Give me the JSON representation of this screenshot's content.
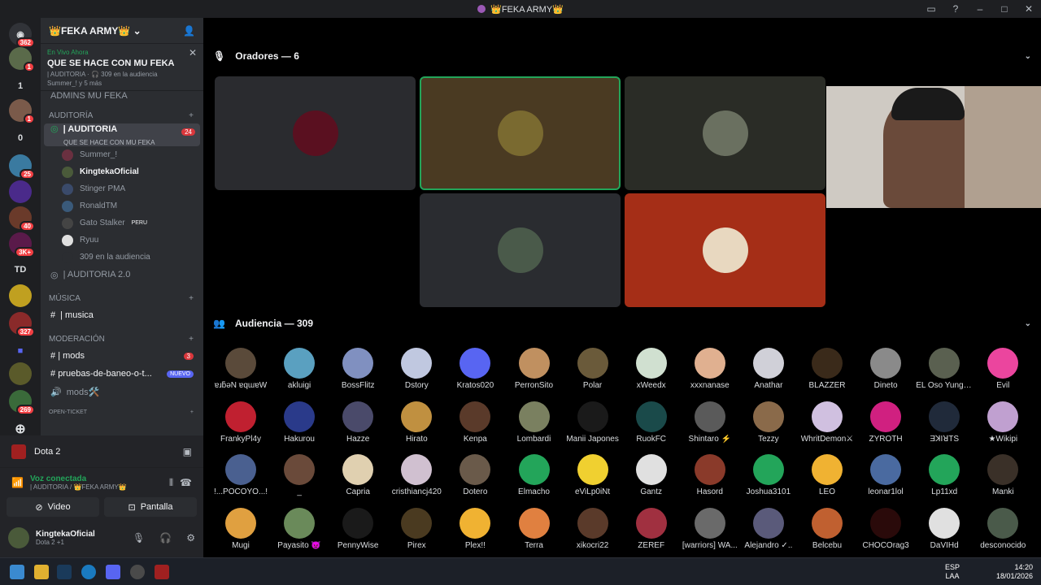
{
  "window": {
    "title": "👑FEKA ARMY👑"
  },
  "rail": {
    "badges": [
      "362",
      "1",
      "1",
      "25",
      "40",
      "3K+",
      "327",
      "269"
    ],
    "texts": [
      "1",
      "0",
      "TD"
    ]
  },
  "sidebar": {
    "server_name": "👑FEKA ARMY👑",
    "live": {
      "tag": "En Vivo Ahora",
      "title": "QUE SE HACE CON MU FEKA",
      "sub": "| AUDITORIA · 🎧 309 en la audiencia",
      "sub2": "Summer_! y 5 más"
    },
    "admins": "ADMINS MU FEKA",
    "cat_auditoria": "AUDITORÍA",
    "stage": {
      "name": "| AUDITORIA",
      "topic": "QUE SE HACE CON MU FEKA",
      "badge": "24"
    },
    "users": [
      {
        "name": "Summer_!",
        "color": "#6a3040"
      },
      {
        "name": "KingtekaOficial",
        "color": "#4a5a3a",
        "bright": true
      },
      {
        "name": "Stinger PMA",
        "color": "#3a4a6a"
      },
      {
        "name": "RonaldTM",
        "color": "#3a5a7a"
      },
      {
        "name": "Gato Stalker",
        "color": "#444",
        "tag": "PERU"
      },
      {
        "name": "Ryuu",
        "color": "#e0e0e0"
      },
      {
        "name": "309 en la audiencia",
        "color": "#2b2d31"
      }
    ],
    "auditoria2": "| AUDITORIA 2.0",
    "cat_musica": "MÚSICA",
    "musica": "| musica",
    "cat_moderacion": "MODERACIÓN",
    "mods": "| mods",
    "mods_badge": "3",
    "pruebas": "pruebas-de-baneo-o-t...",
    "pruebas_badge": "NUEVO",
    "mods2": "mods🛠️",
    "cat_ticket": "OPEN-TICKET"
  },
  "panel": {
    "activity": "Dota 2",
    "voice_status": "Voz conectada",
    "voice_sub": "| AUDITORIA / 👑FEKA ARMY👑",
    "video": "Video",
    "screen": "Pantalla",
    "user": "KingtekaOficial",
    "user_status": "Dota 2 +1"
  },
  "main": {
    "speakers_header": "Oradores — 6",
    "audience_header": "Audiencia — 309",
    "speaker_tiles": [
      {
        "bg": "#2a2b2f",
        "av": "#5a1020"
      },
      {
        "bg": "#4a3a22",
        "av": "#7a6a30"
      },
      {
        "bg": "#2a2c26",
        "av": "#6a7060"
      },
      {
        "bg": "#2a2c30",
        "av": "#4a5a4a"
      },
      {
        "bg": "#a52e17",
        "av": "#e8d8c0"
      }
    ],
    "audience": [
      [
        "ɐɹƃǝN ɐqɯɐW",
        "akluigi",
        "BossFlitz",
        "Dstory",
        "Kratos020",
        "PerronSito",
        "Polar",
        "xWeedx",
        "xxxnanase",
        "Anathar",
        "BLAZZER",
        "Dineto",
        "EL Oso Yungu...",
        "Evil"
      ],
      [
        "FrankyPl4y",
        "Hakurou",
        "Hazze",
        "Hirato",
        "Kenpa",
        "Lombardi",
        "Manii Japones",
        "RuokFC",
        "Shintaro ⚡",
        "Tezzy",
        "WhritDemon⚔",
        "ZYROTH",
        "ƎꓘIꓤTS",
        "★Wikipi"
      ],
      [
        "!...POCOYO...!",
        "_",
        "Capria",
        "cristhiancj420",
        "Dotero",
        "Elmacho",
        "eViLp0iNt",
        "Gantz",
        "Hasord",
        "Joshua3101",
        "LEO",
        "leonar1lol",
        "Lp11xd",
        "Manki"
      ],
      [
        "Mugi",
        "Payasito 👿",
        "PennyWise",
        "Pirex",
        "Plex!!",
        "Terra",
        "xikocri22",
        "ZEREF",
        "[warriors] WA...",
        "Alejandro ✓..",
        "Belcebu",
        "CHOCOrag3",
        "DaVIHd",
        "desconocido"
      ]
    ],
    "audience_colors": [
      [
        "#5a4a3a",
        "#5aa0c0",
        "#8090c0",
        "#c0c8e0",
        "#5865f2",
        "#c09060",
        "#6a5a3a",
        "#d0e0d0",
        "#e0b090",
        "#d0d0d8",
        "#3a2a1a",
        "#8a8a8a",
        "#5a6050",
        "#eb459e"
      ],
      [
        "#c02030",
        "#2a3a8a",
        "#4a4a6a",
        "#c09040",
        "#5a3a2a",
        "#7a8060",
        "#1a1a1a",
        "#1a4a4a",
        "#5a5a5a",
        "#8a6a4a",
        "#d0c0e0",
        "#d02080",
        "#202a3a",
        "#c0a0d0"
      ],
      [
        "#4a6090",
        "#6a4a3a",
        "#e0d0b0",
        "#d0c0d0",
        "#6a5a4a",
        "#23a55a",
        "#f0d030",
        "#e0e0e0",
        "#8a3a2a",
        "#23a55a",
        "#f0b232",
        "#4a6aa0",
        "#23a55a",
        "#3a3028"
      ],
      [
        "#e0a040",
        "#6a8a5a",
        "#1a1a1a",
        "#4a3a20",
        "#f0b232",
        "#e08040",
        "#5a3a2a",
        "#a03040",
        "#6a6a6a",
        "#5a5a7a",
        "#c06030",
        "#2a0a0a",
        "#e0e0e0",
        "#4a5a4a"
      ]
    ]
  },
  "taskbar": {
    "lang": "ESP",
    "lang2": "LAA",
    "time": "14:20",
    "date": "18/01/2026"
  }
}
